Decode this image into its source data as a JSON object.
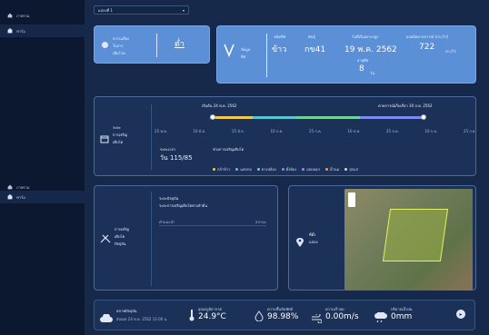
{
  "sidebar": {
    "items": [
      {
        "label": "ภาพรวม",
        "icon": "home-icon",
        "active": false
      },
      {
        "label": "ฟาร์ม",
        "icon": "farm-icon",
        "active": true
      },
      {
        "label": "ภาพรวม",
        "icon": "home-icon",
        "active": false
      },
      {
        "label": "ฟาร์ม",
        "icon": "farm-icon",
        "active": true
      }
    ]
  },
  "header": {
    "dropdown_value": "แปลงที่ 1"
  },
  "weather": {
    "label_line1": "ความเสี่ยง",
    "label_line2": "ในการ",
    "label_line3": "เพิ่มโรค",
    "value": "ต่ำ"
  },
  "crop_info": {
    "label_line1": "ข้อมูล",
    "label_line2": "พืช",
    "crop_type_label": "ชนิดพืช",
    "crop_type": "ข้าว",
    "variety_label": "พันธุ์",
    "variety": "กข41",
    "planting_date_label": "วันที่เริ่มเพาะปลูก",
    "planting_date": "19 พ.ค. 2562",
    "yield_label": "ผลผลิตคาดการณ์ (กก./ไร่)",
    "yield_value": "722",
    "yield_unit": "กก./ไร่",
    "age_label": "อายุพืช",
    "age_value": "8",
    "age_unit": "วัน"
  },
  "growth": {
    "label_line1": "ระยะ",
    "label_line2": "การเจริญ",
    "label_line3": "เติบโต",
    "start_label": "เริ่มต้น 24 พ.ค. 2562",
    "end_label": "คาดการณ์เก็บเกี่ยว 30 ส.ค. 2562",
    "ticks": [
      "25 พ.ค.",
      "10 มิ.ย.",
      "25 มิ.ย.",
      "10 ก.ค.",
      "25 ก.ค.",
      "10 ส.ค.",
      "25 ส.ค.",
      "10 ก.ย.",
      "25 ก.ย."
    ],
    "stage_label": "ระยะเวลา",
    "stage_value": "วัน 115/85",
    "legend_title": "ช่วงการเจริญเติบโต",
    "legend": [
      {
        "label": "กล้าข้าว",
        "color": "#f2c94c"
      },
      {
        "label": "แตกกอ",
        "color": "#5ec3d1"
      },
      {
        "label": "ย่างปล้อง",
        "color": "#6fd39b"
      },
      {
        "label": "ตั้งท้อง",
        "color": "#7b8cf0"
      },
      {
        "label": "ออกดอก",
        "color": "#b37bf0"
      },
      {
        "label": "น้ำนม",
        "color": "#e89c5a"
      },
      {
        "label": "สุกแก่",
        "color": "#e8e08a"
      }
    ]
  },
  "current_stage": {
    "label_line1": "การเจริญ",
    "label_line2": "เติบโต",
    "label_line3": "ปัจจุบัน",
    "panel_title": "ระยะปัจจุบัน",
    "panel_item": "ระยะการเจริญเติบโตทางลำต้น",
    "table_header_left": "คำแนะนำ",
    "table_header_right": "สถานะ"
  },
  "location": {
    "label_line1": "ที่ตั้ง",
    "label_line2": "แปลง"
  },
  "bottom_bar": {
    "status_label": "สภาพปัจจุบัน",
    "status_sub": "อัปเดต 24 พ.ค. 2562 11:00 น.",
    "temp_label": "อุณหภูมิอากาศ",
    "temp_value": "24.9°C",
    "humidity_label": "ความชื้นสัมพัทธ์",
    "humidity_value": "98.98%",
    "wind_label": "ความเร็วลม",
    "wind_value": "0.00m/s",
    "rain_label": "ปริมาณน้ำฝน",
    "rain_value": "0mm"
  }
}
